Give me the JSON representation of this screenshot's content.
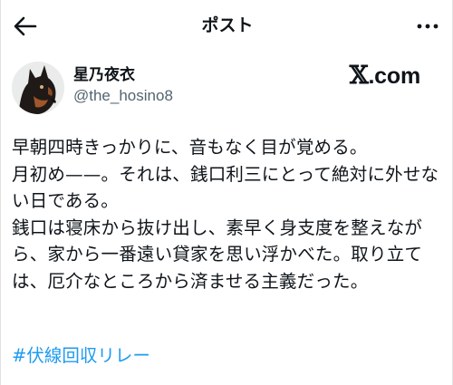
{
  "header": {
    "title": "ポスト",
    "back_icon": "arrow-left-icon",
    "more_icon": "more-horizontal-icon"
  },
  "author": {
    "display_name": "星乃夜衣",
    "handle": "@the_hosino8",
    "avatar_icon": "dog-avatar"
  },
  "brand": {
    "x_mark": "𝕏",
    "suffix": ".com"
  },
  "tweet": {
    "text": "早朝四時きっかりに、音もなく目が覚める。\n月初め——。それは、銭口利三にとって絶対に外せない日である。\n銭口は寝床から抜け出し、素早く身支度を整えながら、家から一番遠い貸家を思い浮かべた。取り立ては、厄介なところから済ませる主義だった。",
    "hashtag": "#伏線回収リレー"
  },
  "colors": {
    "text": "#0f1419",
    "secondary": "#536471",
    "link": "#1d9bf0"
  }
}
